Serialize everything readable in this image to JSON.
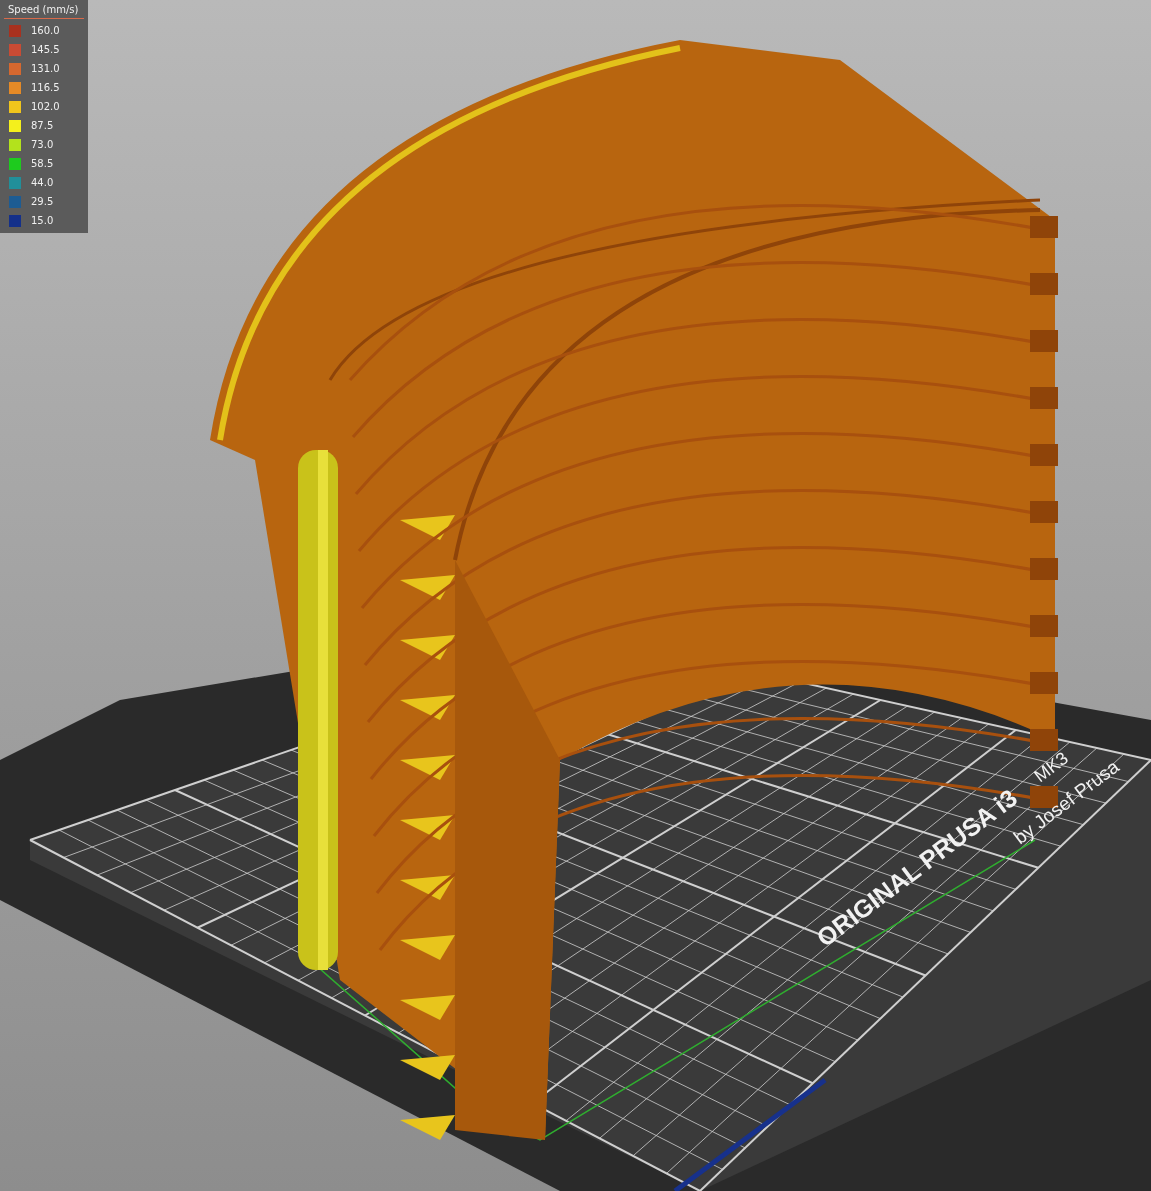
{
  "legend": {
    "title": "Speed (mm/s)",
    "items": [
      {
        "value": "160.0",
        "color": "#a8311f"
      },
      {
        "value": "145.5",
        "color": "#c94b34"
      },
      {
        "value": "131.0",
        "color": "#d6682f"
      },
      {
        "value": "116.5",
        "color": "#e58a26"
      },
      {
        "value": "102.0",
        "color": "#f0c51c"
      },
      {
        "value": "87.5",
        "color": "#f4f01c"
      },
      {
        "value": "73.0",
        "color": "#b3e21c"
      },
      {
        "value": "58.5",
        "color": "#1ecb1e"
      },
      {
        "value": "44.0",
        "color": "#218f9a"
      },
      {
        "value": "29.5",
        "color": "#1d5c93"
      },
      {
        "value": "15.0",
        "color": "#14308a"
      }
    ]
  },
  "bed": {
    "labels": [
      {
        "text": "ORIGINAL PRUSA i3",
        "kind": "brand"
      },
      {
        "text": "MK3",
        "kind": "model"
      },
      {
        "text": "by Josef Prusa",
        "kind": "maker"
      }
    ]
  }
}
